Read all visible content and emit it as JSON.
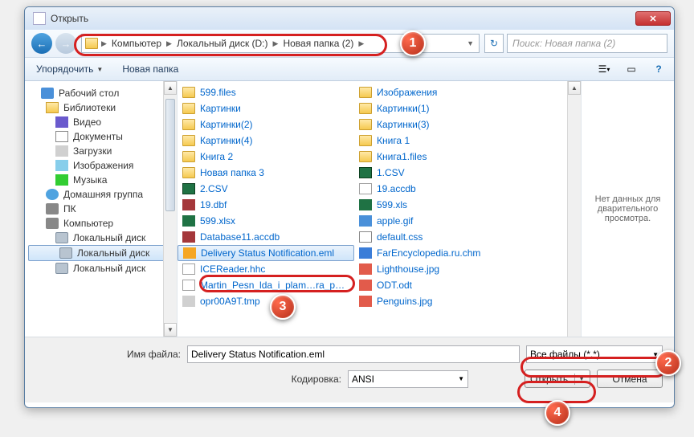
{
  "window": {
    "title": "Открыть"
  },
  "breadcrumb": [
    "Компьютер",
    "Локальный диск (D:)",
    "Новая папка (2)"
  ],
  "search": {
    "placeholder": "Поиск: Новая папка (2)"
  },
  "toolbar": {
    "organize": "Упорядочить",
    "newfolder": "Новая папка"
  },
  "nav": [
    {
      "label": "Рабочий стол",
      "icon": "desktop",
      "level": 0
    },
    {
      "label": "Библиотеки",
      "icon": "lib",
      "level": 1
    },
    {
      "label": "Видео",
      "icon": "video",
      "level": 2
    },
    {
      "label": "Документы",
      "icon": "doc",
      "level": 2
    },
    {
      "label": "Загрузки",
      "icon": "dl",
      "level": 2
    },
    {
      "label": "Изображения",
      "icon": "img",
      "level": 2
    },
    {
      "label": "Музыка",
      "icon": "music",
      "level": 2
    },
    {
      "label": "Домашняя группа",
      "icon": "group",
      "level": 1
    },
    {
      "label": "ПК",
      "icon": "pc",
      "level": 1
    },
    {
      "label": "Компьютер",
      "icon": "pc",
      "level": 1
    },
    {
      "label": "Локальный диск",
      "icon": "drive",
      "level": 2
    },
    {
      "label": "Локальный диск",
      "icon": "drive",
      "level": 2,
      "sel": true
    },
    {
      "label": "Локальный диск",
      "icon": "drive",
      "level": 2
    }
  ],
  "files_col1": [
    {
      "name": "599.files",
      "icon": "fold"
    },
    {
      "name": "Картинки",
      "icon": "fold"
    },
    {
      "name": "Картинки(2)",
      "icon": "fold"
    },
    {
      "name": "Картинки(4)",
      "icon": "fold"
    },
    {
      "name": "Книга 2",
      "icon": "fold"
    },
    {
      "name": "Новая папка 3",
      "icon": "fold"
    },
    {
      "name": "2.CSV",
      "icon": "csv"
    },
    {
      "name": "19.dbf",
      "icon": "db"
    },
    {
      "name": "599.xlsx",
      "icon": "xls"
    },
    {
      "name": "Database11.accdb",
      "icon": "db"
    },
    {
      "name": "Delivery Status Notification.eml",
      "icon": "eml",
      "sel": true
    },
    {
      "name": "ICEReader.hhc",
      "icon": "file"
    },
    {
      "name": "Martin_Pesn_lda_i_plam…ra_p…",
      "icon": "file"
    },
    {
      "name": "opr00A9T.tmp",
      "icon": "tmp"
    }
  ],
  "files_col2": [
    {
      "name": "Изображения",
      "icon": "fold"
    },
    {
      "name": "Картинки(1)",
      "icon": "fold"
    },
    {
      "name": "Картинки(3)",
      "icon": "fold"
    },
    {
      "name": "Книга 1",
      "icon": "fold"
    },
    {
      "name": "Книга1.files",
      "icon": "fold"
    },
    {
      "name": "1.CSV",
      "icon": "csv"
    },
    {
      "name": "19.accdb",
      "icon": "file"
    },
    {
      "name": "599.xls",
      "icon": "xls"
    },
    {
      "name": "apple.gif",
      "icon": "gif"
    },
    {
      "name": "default.css",
      "icon": "css"
    },
    {
      "name": "FarEncyclopedia.ru.chm",
      "icon": "chm"
    },
    {
      "name": "Lighthouse.jpg",
      "icon": "jpg"
    },
    {
      "name": "ODT.odt",
      "icon": "odt"
    },
    {
      "name": "Penguins.jpg",
      "icon": "jpg"
    }
  ],
  "preview": {
    "text": "Нет данных для дварительного просмотра."
  },
  "bottom": {
    "filename_label": "Имя файла:",
    "filename_value": "Delivery Status Notification.eml",
    "encoding_label": "Кодировка:",
    "encoding_value": "ANSI",
    "filter": "Все файлы  (*.*)",
    "open": "Открыть",
    "cancel": "Отмена"
  },
  "callouts": {
    "c1": "1",
    "c2": "2",
    "c3": "3",
    "c4": "4"
  }
}
